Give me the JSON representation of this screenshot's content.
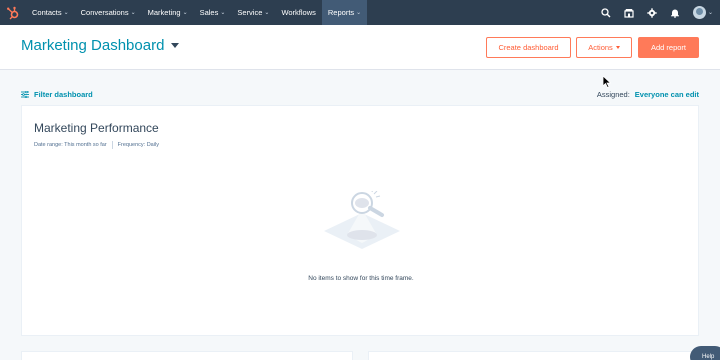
{
  "nav": {
    "items": [
      {
        "label": "Contacts",
        "has_menu": true
      },
      {
        "label": "Conversations",
        "has_menu": true
      },
      {
        "label": "Marketing",
        "has_menu": true
      },
      {
        "label": "Sales",
        "has_menu": true
      },
      {
        "label": "Service",
        "has_menu": true
      },
      {
        "label": "Workflows",
        "has_menu": false
      },
      {
        "label": "Reports",
        "has_menu": true,
        "active": true
      }
    ],
    "right_icons": [
      "search-icon",
      "marketplace-icon",
      "settings-icon",
      "notifications-icon"
    ],
    "brand_color": "#ff7a59",
    "bar_color": "#2d3e50"
  },
  "header": {
    "title": "Marketing Dashboard",
    "create_dashboard_label": "Create dashboard",
    "actions_label": "Actions",
    "add_report_label": "Add report"
  },
  "filter": {
    "filter_label": "Filter dashboard",
    "assigned_label": "Assigned:",
    "assigned_value": "Everyone can edit"
  },
  "report": {
    "title": "Marketing Performance",
    "date_range": "Date range: This month so far",
    "frequency": "Frequency: Daily",
    "empty_message": "No items to show for this time frame."
  },
  "help": {
    "label": "Help"
  }
}
